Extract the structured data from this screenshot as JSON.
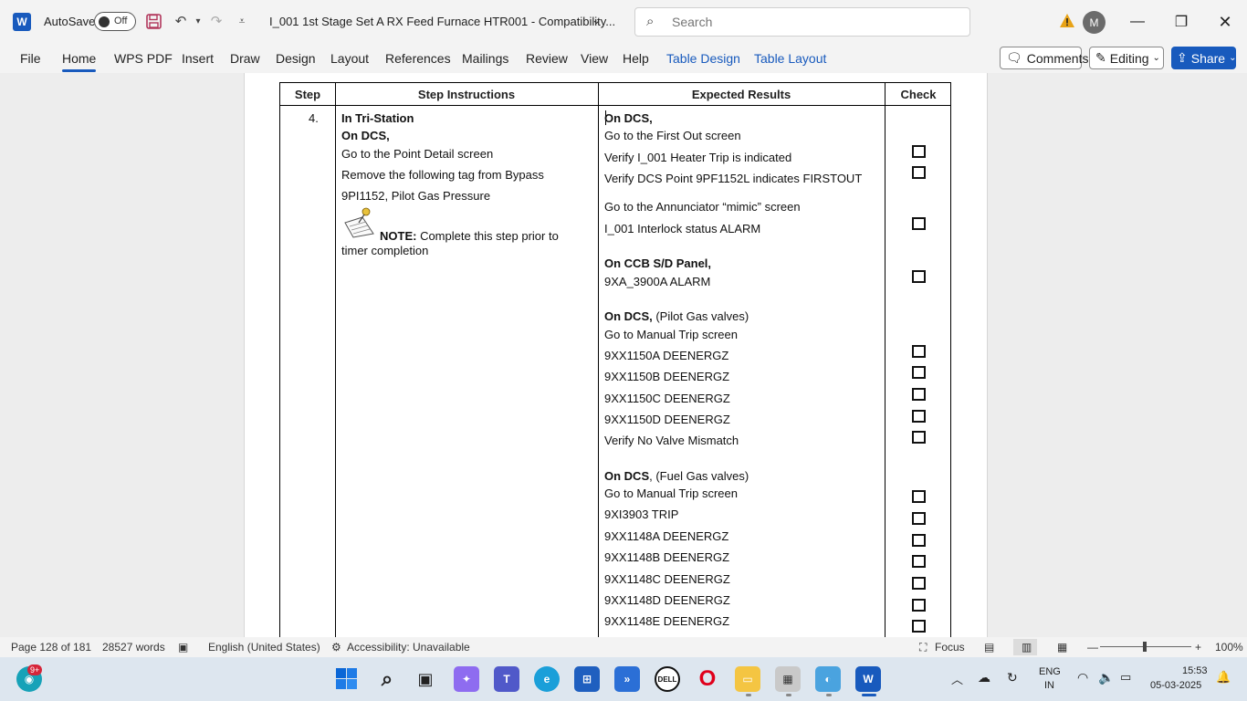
{
  "titlebar": {
    "autosave_label": "AutoSave",
    "autosave_state": "Off",
    "doc_title": "I_001 1st Stage Set A RX Feed Furnace HTR001  -  Compatibility...",
    "search_placeholder": "Search",
    "avatar_initial": "M"
  },
  "ribbon": {
    "tabs": [
      "File",
      "Home",
      "WPS PDF",
      "Insert",
      "Draw",
      "Design",
      "Layout",
      "References",
      "Mailings",
      "Review",
      "View",
      "Help",
      "Table Design",
      "Table Layout"
    ],
    "active_tab": "Home",
    "comments": "Comments",
    "editing": "Editing",
    "share": "Share"
  },
  "table": {
    "headers": [
      "Step",
      "Step Instructions",
      "Expected Results",
      "Check"
    ],
    "step_number": "4.",
    "instructions": {
      "l1": "In Tri-Station",
      "l2": "On DCS,",
      "l3": "Go to the Point Detail screen",
      "l4": "Remove the following tag from Bypass",
      "l5": "9PI1152, Pilot Gas Pressure",
      "note_label": "NOTE:",
      "note_text1": " Complete this step prior to",
      "note_text2": "timer completion"
    },
    "results": {
      "r1": "On DCS,",
      "r2": "Go to the First Out screen",
      "r3": "Verify I_001 Heater Trip is indicated",
      "r4": "Verify DCS Point 9PF1152L indicates FIRSTOUT",
      "r5": "Go to the Annunciator “mimic” screen",
      "r6": "I_001 Interlock status ALARM",
      "r7": "On CCB S/D Panel,",
      "r8": "9XA_3900A ALARM",
      "r9b": "On DCS,",
      "r9": " (Pilot Gas valves)",
      "r10": "Go to Manual Trip screen",
      "r11": "9XX1150A DEENERGZ",
      "r12": "9XX1150B DEENERGZ",
      "r13": "9XX1150C DEENERGZ",
      "r14": "9XX1150D DEENERGZ",
      "r15": "Verify No Valve Mismatch",
      "r16b": "On DCS",
      "r16": ", (Fuel Gas valves)",
      "r17": "Go to Manual Trip screen",
      "r18": "9XI3903 TRIP",
      "r19": "9XX1148A DEENERGZ",
      "r20": "9XX1148B DEENERGZ",
      "r21": "9XX1148C DEENERGZ",
      "r22": "9XX1148D DEENERGZ",
      "r23": "9XX1148E DEENERGZ"
    }
  },
  "statusbar": {
    "page": "Page 128 of 181",
    "words": "28527 words",
    "language": "English (United States)",
    "accessibility": "Accessibility: Unavailable",
    "focus": "Focus",
    "zoom": "100%"
  },
  "taskbar": {
    "badge": "9+",
    "lang1": "ENG",
    "lang2": "IN",
    "time": "15:53",
    "date": "05-03-2025"
  }
}
